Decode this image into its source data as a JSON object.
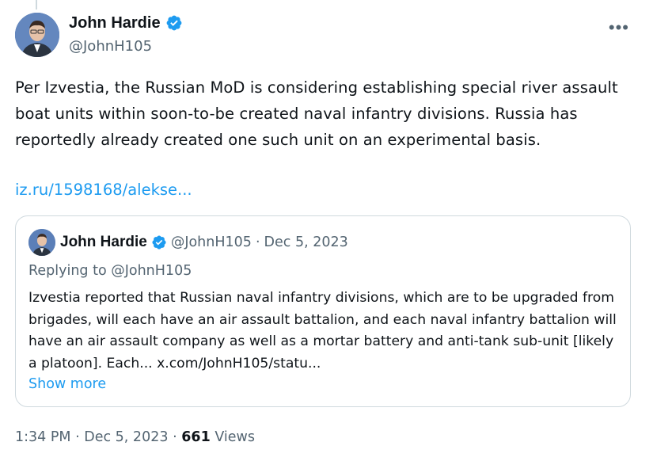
{
  "author": {
    "name": "John Hardie",
    "handle": "@JohnH105"
  },
  "tweet": {
    "text": "Per Izvestia, the Russian MoD is considering establishing special river assault boat units within soon-to-be created naval infantry divisions. Russia has reportedly already created one such unit on an experimental basis.",
    "link": "iz.ru/1598168/alekse..."
  },
  "quote": {
    "name": "John Hardie",
    "handle": "@JohnH105",
    "separator": "·",
    "date": "Dec 5, 2023",
    "replying_to": "Replying to @JohnH105",
    "text": "Izvestia reported that Russian naval infantry divisions, which are to be upgraded from brigades, will each have an air assault battalion, and each naval infantry battalion will have an air assault company as well as a mortar battery and anti-tank sub-unit [likely a platoon]. Each... x.com/JohnH105/statu...",
    "show_more": "Show more"
  },
  "meta": {
    "time": "1:34 PM",
    "separator": "·",
    "date": "Dec 5, 2023",
    "views_count": "661",
    "views_label": "Views"
  },
  "icons": {
    "verified": "verified-badge-icon",
    "more": "more-options-icon"
  },
  "colors": {
    "accent": "#1d9bf0",
    "secondary_text": "#536471",
    "border": "#cfd9de"
  }
}
